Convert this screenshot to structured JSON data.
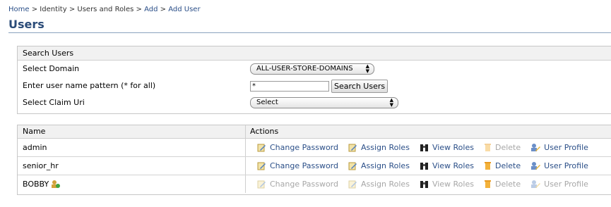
{
  "breadcrumb": {
    "items": [
      "Home",
      "Identity",
      "Users and Roles",
      "Add",
      "Add User"
    ],
    "separator": ">"
  },
  "page": {
    "title": "Users"
  },
  "search": {
    "header": "Search Users",
    "domain_label": "Select Domain",
    "domain_value": "ALL-USER-STORE-DOMAINS",
    "pattern_label": "Enter user name pattern (* for all)",
    "pattern_value": "*",
    "search_button": "Search Users",
    "claim_label": "Select Claim Uri",
    "claim_value": "Select"
  },
  "users_table": {
    "columns": [
      "Name",
      "Actions"
    ],
    "action_labels": {
      "change_password": "Change Password",
      "assign_roles": "Assign Roles",
      "view_roles": "View Roles",
      "delete": "Delete",
      "user_profile": "User Profile"
    },
    "rows": [
      {
        "name": "admin"
      },
      {
        "name": "senior_hr"
      },
      {
        "name": "BOBBY"
      }
    ]
  },
  "colors": {
    "link": "#2b4f88",
    "title": "#2a4b78",
    "disabled": "#a7a7a7"
  }
}
